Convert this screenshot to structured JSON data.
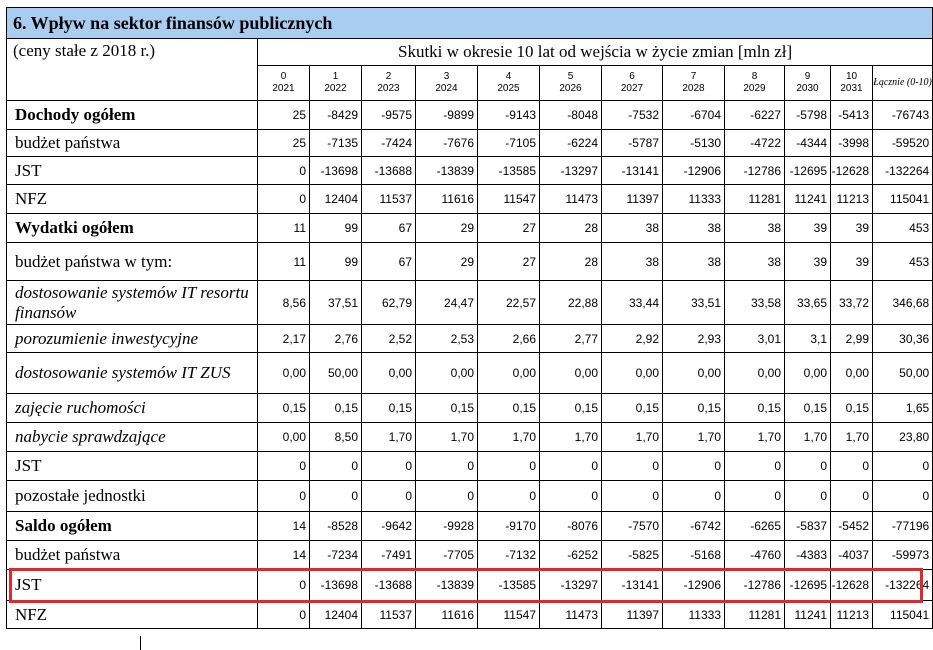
{
  "section_title": "6. Wpływ na sektor finansów publicznych",
  "price_note": "(ceny stałe z 2018 r.)",
  "period_header": "Skutki w okresie 10 lat od wejścia w życie zmian [mln zł]",
  "years": [
    {
      "index": "0",
      "year": "2021"
    },
    {
      "index": "1",
      "year": "2022"
    },
    {
      "index": "2",
      "year": "2023"
    },
    {
      "index": "3",
      "year": "2024"
    },
    {
      "index": "4",
      "year": "2025"
    },
    {
      "index": "5",
      "year": "2026"
    },
    {
      "index": "6",
      "year": "2027"
    },
    {
      "index": "7",
      "year": "2028"
    },
    {
      "index": "8",
      "year": "2029"
    },
    {
      "index": "9",
      "year": "2030"
    },
    {
      "index": "10",
      "year": "2031"
    }
  ],
  "total_header": "Łącznie (0-10)",
  "rows": [
    {
      "label": "Dochody ogółem",
      "style": "bold",
      "values": [
        "25",
        "-8429",
        "-9575",
        "-9899",
        "-9143",
        "-8048",
        "-7532",
        "-6704",
        "-6227",
        "-5798",
        "-5413",
        "-76743"
      ]
    },
    {
      "label": "budżet państwa",
      "style": "normal",
      "values": [
        "25",
        "-7135",
        "-7424",
        "-7676",
        "-7105",
        "-6224",
        "-5787",
        "-5130",
        "-4722",
        "-4344",
        "-3998",
        "-59520"
      ]
    },
    {
      "label": "JST",
      "style": "normal",
      "values": [
        "0",
        "-13698",
        "-13688",
        "-13839",
        "-13585",
        "-13297",
        "-13141",
        "-12906",
        "-12786",
        "-12695",
        "-12628",
        "-132264"
      ]
    },
    {
      "label": "NFZ",
      "style": "normal",
      "values": [
        "0",
        "12404",
        "11537",
        "11616",
        "11547",
        "11473",
        "11397",
        "11333",
        "11281",
        "11241",
        "11213",
        "115041"
      ]
    },
    {
      "label": "Wydatki ogółem",
      "style": "bold",
      "values": [
        "11",
        "99",
        "67",
        "29",
        "27",
        "28",
        "38",
        "38",
        "38",
        "39",
        "39",
        "453"
      ]
    },
    {
      "label": "budżet państwa w tym:",
      "style": "normal",
      "values": [
        "11",
        "99",
        "67",
        "29",
        "27",
        "28",
        "38",
        "38",
        "38",
        "39",
        "39",
        "453"
      ]
    },
    {
      "label": "dostosowanie systemów IT resortu finansów",
      "style": "italic",
      "values": [
        "8,56",
        "37,51",
        "62,79",
        "24,47",
        "22,57",
        "22,88",
        "33,44",
        "33,51",
        "33,58",
        "33,65",
        "33,72",
        "346,68"
      ]
    },
    {
      "label": "porozumienie inwestycyjne",
      "style": "italic",
      "values": [
        "2,17",
        "2,76",
        "2,52",
        "2,53",
        "2,66",
        "2,77",
        "2,92",
        "2,93",
        "3,01",
        "3,1",
        "2,99",
        "30,36"
      ]
    },
    {
      "label": "dostosowanie systemów IT ZUS",
      "style": "italic",
      "values": [
        "0,00",
        "50,00",
        "0,00",
        "0,00",
        "0,00",
        "0,00",
        "0,00",
        "0,00",
        "0,00",
        "0,00",
        "0,00",
        "50,00"
      ]
    },
    {
      "label": "zajęcie ruchomości",
      "style": "italic",
      "values": [
        "0,15",
        "0,15",
        "0,15",
        "0,15",
        "0,15",
        "0,15",
        "0,15",
        "0,15",
        "0,15",
        "0,15",
        "0,15",
        "1,65"
      ]
    },
    {
      "label": "nabycie sprawdzające",
      "style": "italic",
      "values": [
        "0,00",
        "8,50",
        "1,70",
        "1,70",
        "1,70",
        "1,70",
        "1,70",
        "1,70",
        "1,70",
        "1,70",
        "1,70",
        "23,80"
      ]
    },
    {
      "label": "JST",
      "style": "normal",
      "values": [
        "0",
        "0",
        "0",
        "0",
        "0",
        "0",
        "0",
        "0",
        "0",
        "0",
        "0",
        "0"
      ]
    },
    {
      "label": "pozostałe jednostki",
      "style": "normal",
      "values": [
        "0",
        "0",
        "0",
        "0",
        "0",
        "0",
        "0",
        "0",
        "0",
        "0",
        "0",
        "0"
      ]
    },
    {
      "label": "Saldo ogółem",
      "style": "bold",
      "values": [
        "14",
        "-8528",
        "-9642",
        "-9928",
        "-9170",
        "-8076",
        "-7570",
        "-6742",
        "-6265",
        "-5837",
        "-5452",
        "-77196"
      ]
    },
    {
      "label": "budżet państwa",
      "style": "normal",
      "values": [
        "14",
        "-7234",
        "-7491",
        "-7705",
        "-7132",
        "-6252",
        "-5825",
        "-5168",
        "-4760",
        "-4383",
        "-4037",
        "-59973"
      ]
    },
    {
      "label": "JST",
      "style": "normal",
      "values": [
        "0",
        "-13698",
        "-13688",
        "-13839",
        "-13585",
        "-13297",
        "-13141",
        "-12906",
        "-12786",
        "-12695",
        "-12628",
        "-132264"
      ]
    },
    {
      "label": "NFZ",
      "style": "normal",
      "values": [
        "0",
        "12404",
        "11537",
        "11616",
        "11547",
        "11473",
        "11397",
        "11333",
        "11281",
        "11241",
        "11213",
        "115041"
      ]
    }
  ],
  "highlighted_row": 15,
  "highlight_color": "#e0282e",
  "title_bg_color": "#a8cdf0"
}
